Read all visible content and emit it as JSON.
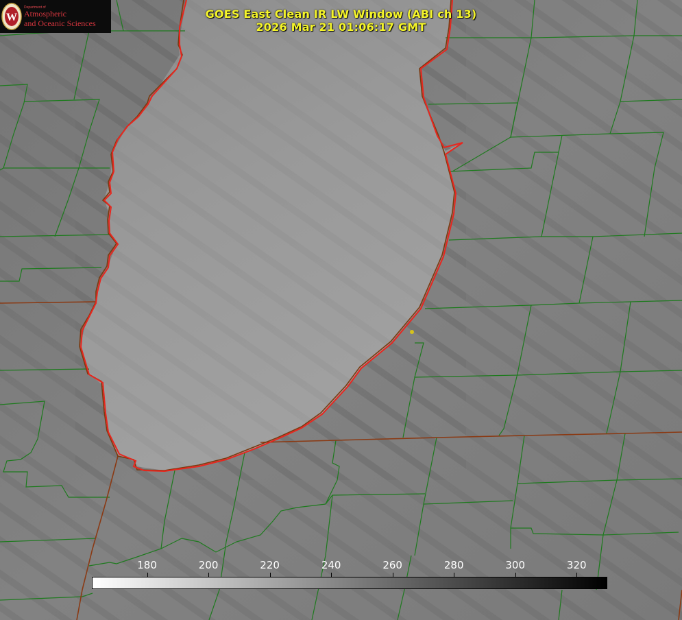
{
  "title": {
    "line1": "GOES East Clean IR LW Window (ABI ch 13)",
    "line2": "2026 Mar 21 01:06:17 GMT"
  },
  "logo": {
    "department": "Department of",
    "line1": "Atmospheric",
    "line2": "and Oceanic Sciences",
    "seal_letter": "W",
    "seal_icon": "uw-crest-icon"
  },
  "colorbar": {
    "min": 162,
    "max": 330,
    "ticks": [
      180,
      200,
      220,
      240,
      260,
      280,
      300,
      320
    ],
    "gradient": [
      "#ffffff",
      "#000000"
    ]
  },
  "colors": {
    "county_lines": "#1e7a1e",
    "lake_outline": "#e8261e",
    "state_lines": "#8a3a14",
    "title_text": "#f5f52a",
    "marker": "#d6c21c"
  }
}
